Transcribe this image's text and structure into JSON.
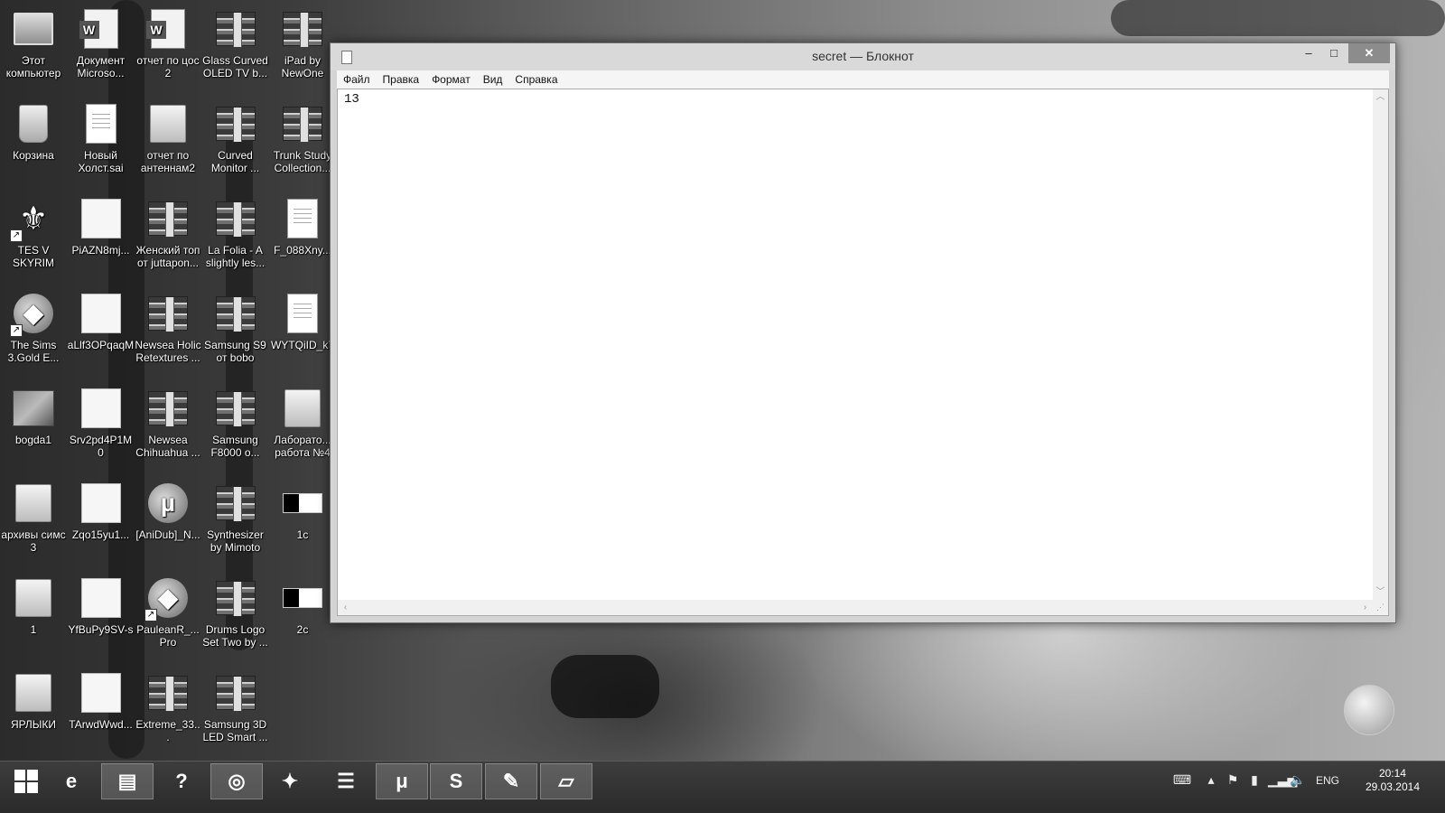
{
  "desktop": {
    "icons": [
      {
        "label": "Этот компьютер",
        "icon": "computer-icon"
      },
      {
        "label": "Документ Microsо...",
        "icon": "word-document-icon"
      },
      {
        "label": "отчет по цос 2",
        "icon": "word-document-icon"
      },
      {
        "label": "Glass Curved OLED TV b...",
        "icon": "archive-icon"
      },
      {
        "label": "iPad by NewOne",
        "icon": "archive-icon"
      },
      {
        "label": "Корзина",
        "icon": "recycle-bin-icon"
      },
      {
        "label": "Новый Холст.sai",
        "icon": "file-icon"
      },
      {
        "label": "отчет по антеннам2",
        "icon": "folder-icon"
      },
      {
        "label": "Curved Monitor ...",
        "icon": "archive-icon"
      },
      {
        "label": "Trunk Study Collection...",
        "icon": "archive-icon"
      },
      {
        "label": "TES V SKYRIM",
        "icon": "skyrim-icon"
      },
      {
        "label": "PiAZN8mj...",
        "icon": "image-icon"
      },
      {
        "label": "Женский топ от juttapon...",
        "icon": "archive-icon"
      },
      {
        "label": "La Folia - A slightly les...",
        "icon": "archive-icon"
      },
      {
        "label": "F_088Xny...",
        "icon": "file-icon"
      },
      {
        "label": "The Sims 3.Gold E...",
        "icon": "sims-icon"
      },
      {
        "label": "aLlf3OPqaqM",
        "icon": "image-icon"
      },
      {
        "label": "Newsea Holic Retextures ...",
        "icon": "archive-icon"
      },
      {
        "label": "Samsung S9 от bobo",
        "icon": "archive-icon"
      },
      {
        "label": "WYTQiID_k7",
        "icon": "file-icon"
      },
      {
        "label": "bogda1",
        "icon": "photo-icon"
      },
      {
        "label": "Srv2pd4P1M0",
        "icon": "image-icon"
      },
      {
        "label": "Newsea Chihuahua ...",
        "icon": "archive-icon"
      },
      {
        "label": "Samsung F8000 о...",
        "icon": "archive-icon"
      },
      {
        "label": "Лаборато... работа №4",
        "icon": "folder-icon"
      },
      {
        "label": "архивы симс 3",
        "icon": "folder-icon"
      },
      {
        "label": "Zqo15yu1...",
        "icon": "image-icon"
      },
      {
        "label": "[AniDub]_N...",
        "icon": "utorrent-icon"
      },
      {
        "label": "Synthesizer by Mimoto",
        "icon": "archive-icon"
      },
      {
        "label": "1c",
        "icon": "bw-image-icon"
      },
      {
        "label": "1",
        "icon": "folder-icon"
      },
      {
        "label": "YfBuPy9SV-s",
        "icon": "image-icon"
      },
      {
        "label": "PauleanR_... Pro",
        "icon": "sims-icon"
      },
      {
        "label": "Drums Logo Set Two by ...",
        "icon": "archive-icon"
      },
      {
        "label": "2c",
        "icon": "bw-image-icon"
      },
      {
        "label": "ЯРЛЫКИ",
        "icon": "folder-icon"
      },
      {
        "label": "TArwdWwd...",
        "icon": "image-icon"
      },
      {
        "label": "Extreme_33...",
        "icon": "archive-icon"
      },
      {
        "label": "Samsung 3D LED Smart ...",
        "icon": "archive-icon"
      }
    ]
  },
  "notepad": {
    "title": "secret — Блокнот",
    "menu": [
      "Файл",
      "Правка",
      "Формат",
      "Вид",
      "Справка"
    ],
    "content": "13",
    "controls": {
      "minimize": "–",
      "maximize": "□",
      "close": "✕"
    }
  },
  "taskbar": {
    "items": [
      {
        "name": "start-button",
        "icon": "windows-logo-icon"
      },
      {
        "name": "taskbar-internet-explorer",
        "icon": "internet-explorer-icon",
        "glyph": "e"
      },
      {
        "name": "taskbar-file-explorer",
        "icon": "folder-icon",
        "glyph": "▤"
      },
      {
        "name": "taskbar-help",
        "icon": "help-icon",
        "glyph": "?"
      },
      {
        "name": "taskbar-chrome",
        "icon": "chrome-icon",
        "glyph": "◎"
      },
      {
        "name": "taskbar-app",
        "icon": "app-icon",
        "glyph": "✦"
      },
      {
        "name": "taskbar-equalizer",
        "icon": "equalizer-icon",
        "glyph": "☰"
      },
      {
        "name": "taskbar-utorrent",
        "icon": "utorrent-icon",
        "glyph": "μ"
      },
      {
        "name": "taskbar-skype",
        "icon": "skype-icon",
        "glyph": "S"
      },
      {
        "name": "taskbar-paint",
        "icon": "paint-icon",
        "glyph": "✎"
      },
      {
        "name": "taskbar-notepad",
        "icon": "notepad-icon",
        "glyph": "▱"
      }
    ],
    "tray": {
      "language": "ENG",
      "time": "20:14",
      "date": "29.03.2014"
    }
  }
}
